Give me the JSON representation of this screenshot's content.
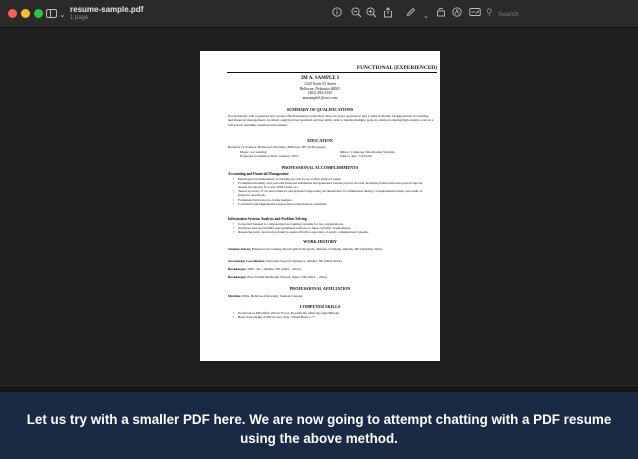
{
  "window": {
    "doc_title": "resume-sample.pdf",
    "doc_subtitle": "1 page",
    "search_placeholder": "Search",
    "toolbar_icons": [
      "info-icon",
      "zoom-out-icon",
      "zoom-in-icon",
      "share-icon",
      "pen-icon",
      "chevron-down-icon",
      "rotate-icon",
      "markup-icon",
      "form-icon"
    ]
  },
  "resume": {
    "header": "FUNCTIONAL (EXPERIENCED)",
    "name": "IM A. SAMPLE I",
    "address": [
      "1234 North 55 Street",
      "Bellevue, Nebraska 68005",
      "(402) 292-2345",
      "imasample1@xxx.com"
    ],
    "summary_heading": "SUMMARY OF QUALIFICATIONS",
    "summary_text": "Exceptionally well organized and resourceful Professional with more than six years experience and a solid academic background in accounting and financial management; excellent analytical and problem solving skills; able to handle multiple projects while producing high quality work in a fast-paced, deadline-oriented environment.",
    "education_heading": "EDUCATION",
    "education_line": "Bachelor of Science, Bellevue University, Bellevue, NE (In Progress)",
    "edu_major_left": "Major: Accounting",
    "edu_major_right": "Minor: Computer Information Systems",
    "edu_grad_left": "Expected Graduation Date: January, 20xx",
    "edu_grad_right": "GPA to date: 3.93/4.00",
    "accomplishments_heading": "PROFESSIONAL ACCOMPLISHMENTS",
    "acc_sub1": "Accounting and Financial Management",
    "acc_items1": [
      "Developed and maintained accounting records for up to fifty bank accounts.",
      "Formulated monthly and year-end financial statements and generated various payroll records, including federal and state payroll reports, annual tax reports, W-2 and 1099 forms, etc.",
      "Tested accuracy of account balances and prepared supporting documentation for submission during a comprehensive three year audit of financial operations.",
      "Formulated intricate pro-forma budgets.",
      "Calculated and implemented depreciation/amortization schedules."
    ],
    "acc_sub2": "Information Systems Analysis and Problem Solving",
    "acc_items2": [
      "Converted manual to computerized accounting systems for two organizations.",
      "Analyzed and successfully reprogrammed software to meet customer requirements.",
      "Researched and corrected problem to assure effective operation of newly computerized systems."
    ],
    "work_heading": "WORK HISTORY",
    "work_items": [
      {
        "title": "Student Intern,",
        "rest": " Financial Accounting Development Program, Mutual of Omaha, Omaha, NE (Summer 20xx)"
      },
      {
        "title": "Accounting Coordinator,",
        "rest": " Nebraska Special Olympics, Omaha, NE (20xx-20xx)"
      },
      {
        "title": "Bookkeeper,",
        "rest": " SMC, Inc., Omaha, NE (20xx – 20xx)"
      },
      {
        "title": "Bookkeeper,",
        "rest": " First United Methodist Church, Altus, OK (20xx – 20xx)"
      }
    ],
    "affiliation_heading": "PROFESSIONAL AFFILIATION",
    "affiliation_title": "Member,",
    "affiliation_rest": " IMA, Bellevue University Student Chapter",
    "skills_heading": "COMPUTER SKILLS",
    "skills_items": [
      "Proficient in MS Office (Word, Excel, PowerPoint, Outlook), QuickBooks",
      "Basic Knowledge of MS Access, SQL, Visual Basic C++"
    ]
  },
  "caption": {
    "text": "Let us try with a smaller PDF here. We are now going to attempt chatting with a PDF resume using the above method."
  }
}
